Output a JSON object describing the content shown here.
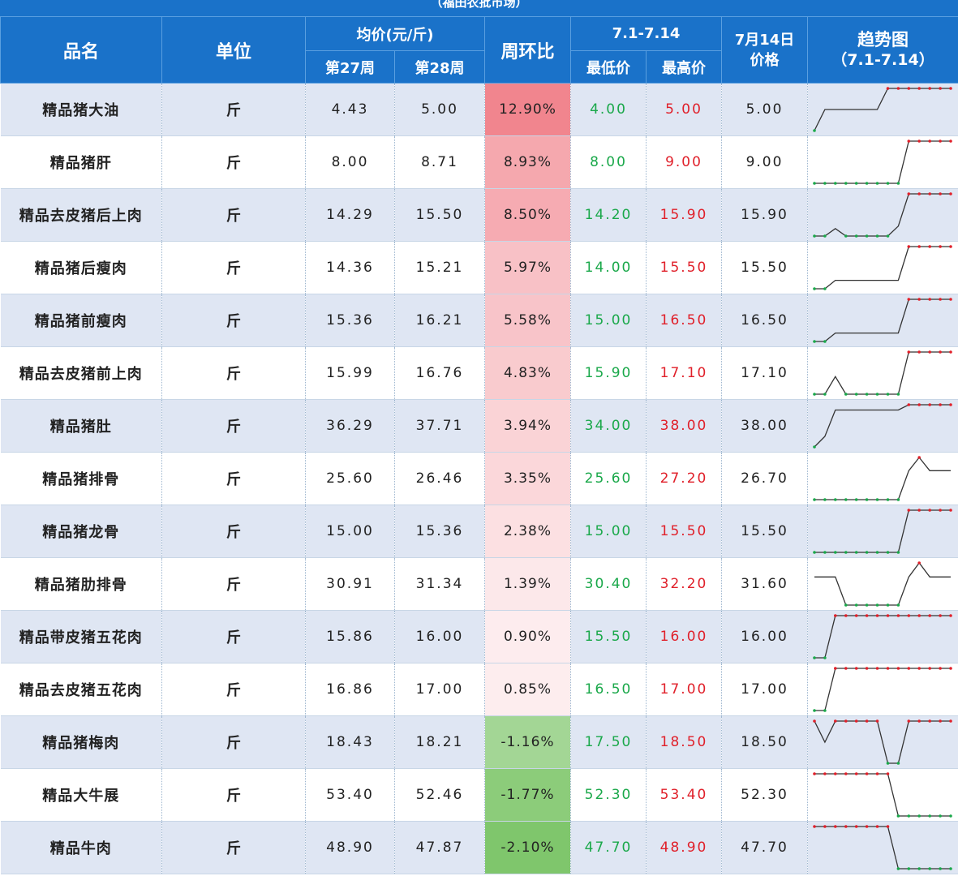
{
  "banner": "（福田农批市场）",
  "header": {
    "name": "品名",
    "unit": "单位",
    "avg_group": "均价(元/斤)",
    "week27": "第27周",
    "week28": "第28周",
    "wow": "周环比",
    "range_group": "7.1-7.14",
    "min": "最低价",
    "max": "最高价",
    "price_line1": "7月14日",
    "price_line2": "价格",
    "trend_line1": "趋势图",
    "trend_line2": "（7.1-7.14）"
  },
  "colors": {
    "header_bg": "#1a72c9",
    "row_odd": "#dfe6f3",
    "low": "#1aa84a",
    "high": "#e0202a",
    "rise_bg": "#f3a8ad",
    "fall_bg": "#7fc66a"
  },
  "rows": [
    {
      "name": "精品猪大油",
      "unit": "斤",
      "w27": "4.43",
      "w28": "5.00",
      "wow": "12.90%",
      "wow_value": 12.9,
      "min": "4.00",
      "max": "5.00",
      "price": "5.00",
      "trend": [
        4.0,
        4.5,
        4.5,
        4.5,
        4.5,
        4.5,
        4.5,
        5.0,
        5.0,
        5.0,
        5.0,
        5.0,
        5.0,
        5.0
      ]
    },
    {
      "name": "精品猪肝",
      "unit": "斤",
      "w27": "8.00",
      "w28": "8.71",
      "wow": "8.93%",
      "wow_value": 8.93,
      "min": "8.00",
      "max": "9.00",
      "price": "9.00",
      "trend": [
        8.0,
        8.0,
        8.0,
        8.0,
        8.0,
        8.0,
        8.0,
        8.0,
        8.0,
        9.0,
        9.0,
        9.0,
        9.0,
        9.0
      ]
    },
    {
      "name": "精品去皮猪后上肉",
      "unit": "斤",
      "w27": "14.29",
      "w28": "15.50",
      "wow": "8.50%",
      "wow_value": 8.5,
      "min": "14.20",
      "max": "15.90",
      "price": "15.90",
      "trend": [
        14.2,
        14.2,
        14.5,
        14.2,
        14.2,
        14.2,
        14.2,
        14.2,
        14.6,
        15.9,
        15.9,
        15.9,
        15.9,
        15.9
      ]
    },
    {
      "name": "精品猪后瘦肉",
      "unit": "斤",
      "w27": "14.36",
      "w28": "15.21",
      "wow": "5.97%",
      "wow_value": 5.97,
      "min": "14.00",
      "max": "15.50",
      "price": "15.50",
      "trend": [
        14.0,
        14.0,
        14.3,
        14.3,
        14.3,
        14.3,
        14.3,
        14.3,
        14.3,
        15.5,
        15.5,
        15.5,
        15.5,
        15.5
      ]
    },
    {
      "name": "精品猪前瘦肉",
      "unit": "斤",
      "w27": "15.36",
      "w28": "16.21",
      "wow": "5.58%",
      "wow_value": 5.58,
      "min": "15.00",
      "max": "16.50",
      "price": "16.50",
      "trend": [
        15.0,
        15.0,
        15.3,
        15.3,
        15.3,
        15.3,
        15.3,
        15.3,
        15.3,
        16.5,
        16.5,
        16.5,
        16.5,
        16.5
      ]
    },
    {
      "name": "精品去皮猪前上肉",
      "unit": "斤",
      "w27": "15.99",
      "w28": "16.76",
      "wow": "4.83%",
      "wow_value": 4.83,
      "min": "15.90",
      "max": "17.10",
      "price": "17.10",
      "trend": [
        15.9,
        15.9,
        16.4,
        15.9,
        15.9,
        15.9,
        15.9,
        15.9,
        15.9,
        17.1,
        17.1,
        17.1,
        17.1,
        17.1
      ]
    },
    {
      "name": "精品猪肚",
      "unit": "斤",
      "w27": "36.29",
      "w28": "37.71",
      "wow": "3.94%",
      "wow_value": 3.94,
      "min": "34.00",
      "max": "38.00",
      "price": "38.00",
      "trend": [
        34.0,
        35.0,
        37.5,
        37.5,
        37.5,
        37.5,
        37.5,
        37.5,
        37.5,
        38.0,
        38.0,
        38.0,
        38.0,
        38.0
      ]
    },
    {
      "name": "精品猪排骨",
      "unit": "斤",
      "w27": "25.60",
      "w28": "26.46",
      "wow": "3.35%",
      "wow_value": 3.35,
      "min": "25.60",
      "max": "27.20",
      "price": "26.70",
      "trend": [
        25.6,
        25.6,
        25.6,
        25.6,
        25.6,
        25.6,
        25.6,
        25.6,
        25.6,
        26.7,
        27.2,
        26.7,
        26.7,
        26.7
      ]
    },
    {
      "name": "精品猪龙骨",
      "unit": "斤",
      "w27": "15.00",
      "w28": "15.36",
      "wow": "2.38%",
      "wow_value": 2.38,
      "min": "15.00",
      "max": "15.50",
      "price": "15.50",
      "trend": [
        15.0,
        15.0,
        15.0,
        15.0,
        15.0,
        15.0,
        15.0,
        15.0,
        15.0,
        15.5,
        15.5,
        15.5,
        15.5,
        15.5
      ]
    },
    {
      "name": "精品猪肋排骨",
      "unit": "斤",
      "w27": "30.91",
      "w28": "31.34",
      "wow": "1.39%",
      "wow_value": 1.39,
      "min": "30.40",
      "max": "32.20",
      "price": "31.60",
      "trend": [
        31.6,
        31.6,
        31.6,
        30.4,
        30.4,
        30.4,
        30.4,
        30.4,
        30.4,
        31.6,
        32.2,
        31.6,
        31.6,
        31.6
      ]
    },
    {
      "name": "精品带皮猪五花肉",
      "unit": "斤",
      "w27": "15.86",
      "w28": "16.00",
      "wow": "0.90%",
      "wow_value": 0.9,
      "min": "15.50",
      "max": "16.00",
      "price": "16.00",
      "trend": [
        15.5,
        15.5,
        16.0,
        16.0,
        16.0,
        16.0,
        16.0,
        16.0,
        16.0,
        16.0,
        16.0,
        16.0,
        16.0,
        16.0
      ]
    },
    {
      "name": "精品去皮猪五花肉",
      "unit": "斤",
      "w27": "16.86",
      "w28": "17.00",
      "wow": "0.85%",
      "wow_value": 0.85,
      "min": "16.50",
      "max": "17.00",
      "price": "17.00",
      "trend": [
        16.5,
        16.5,
        17.0,
        17.0,
        17.0,
        17.0,
        17.0,
        17.0,
        17.0,
        17.0,
        17.0,
        17.0,
        17.0,
        17.0
      ]
    },
    {
      "name": "精品猪梅肉",
      "unit": "斤",
      "w27": "18.43",
      "w28": "18.21",
      "wow": "-1.16%",
      "wow_value": -1.16,
      "min": "17.50",
      "max": "18.50",
      "price": "18.50",
      "trend": [
        18.5,
        18.0,
        18.5,
        18.5,
        18.5,
        18.5,
        18.5,
        17.5,
        17.5,
        18.5,
        18.5,
        18.5,
        18.5,
        18.5
      ]
    },
    {
      "name": "精品大牛展",
      "unit": "斤",
      "w27": "53.40",
      "w28": "52.46",
      "wow": "-1.77%",
      "wow_value": -1.77,
      "min": "52.30",
      "max": "53.40",
      "price": "52.30",
      "trend": [
        53.4,
        53.4,
        53.4,
        53.4,
        53.4,
        53.4,
        53.4,
        53.4,
        52.3,
        52.3,
        52.3,
        52.3,
        52.3,
        52.3
      ]
    },
    {
      "name": "精品牛肉",
      "unit": "斤",
      "w27": "48.90",
      "w28": "47.87",
      "wow": "-2.10%",
      "wow_value": -2.1,
      "min": "47.70",
      "max": "48.90",
      "price": "47.70",
      "trend": [
        48.9,
        48.9,
        48.9,
        48.9,
        48.9,
        48.9,
        48.9,
        48.9,
        47.7,
        47.7,
        47.7,
        47.7,
        47.7,
        47.7
      ]
    }
  ]
}
